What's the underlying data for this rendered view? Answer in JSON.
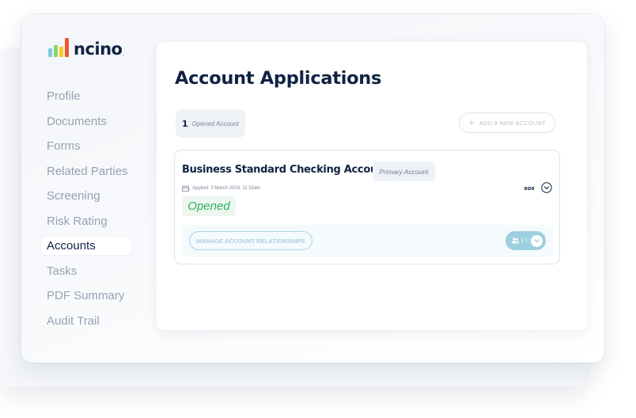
{
  "brand": {
    "name": "ncino",
    "bar_colors": [
      "#7fcbe6",
      "#8bd26b",
      "#f5c928",
      "#ee5a2c"
    ],
    "text_color": "#0f2343"
  },
  "sidebar": {
    "items": [
      {
        "label": "Profile",
        "active": false
      },
      {
        "label": "Documents",
        "active": false
      },
      {
        "label": "Forms",
        "active": false
      },
      {
        "label": "Related Parties",
        "active": false
      },
      {
        "label": "Screening",
        "active": false
      },
      {
        "label": "Risk Rating",
        "active": false
      },
      {
        "label": "Accounts",
        "active": true
      },
      {
        "label": "Tasks",
        "active": false
      },
      {
        "label": "PDF Summary",
        "active": false
      },
      {
        "label": "Audit Trail",
        "active": false
      }
    ]
  },
  "main": {
    "title": "Account Applications",
    "summary": {
      "count": "1",
      "label": "Opened Account"
    },
    "add_button": {
      "icon": "plus-icon",
      "label": "ADD A NEW ACCOUNT"
    },
    "accounts": [
      {
        "name": "Business Standard Checking Account",
        "tag": "Primary Account",
        "applied": "Applied: 3 March 2024, 11:32am",
        "status": "Opened",
        "status_color": "#2db35b",
        "manage_label": "MANAGE ACCOUNT RELATIONSHIPS",
        "relationship_count": "1",
        "relationship_icon": "users-icon"
      }
    ]
  }
}
